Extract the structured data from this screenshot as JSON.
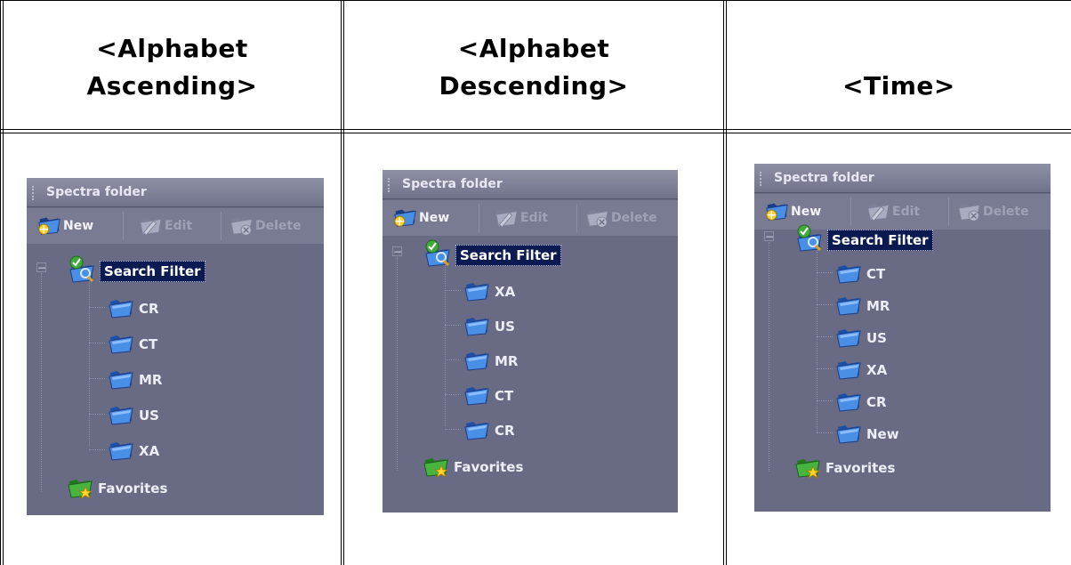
{
  "columns": [
    {
      "header": [
        "<Alphabet",
        "Ascending>"
      ],
      "panel": {
        "title": "Spectra folder",
        "toolbar": {
          "new": "New",
          "edit": "Edit",
          "delete": "Delete"
        },
        "root": "Search Filter",
        "children": [
          "CR",
          "CT",
          "MR",
          "US",
          "XA"
        ],
        "favorites": "Favorites"
      }
    },
    {
      "header": [
        "<Alphabet",
        "Descending>"
      ],
      "panel": {
        "title": "Spectra folder",
        "toolbar": {
          "new": "New",
          "edit": "Edit",
          "delete": "Delete"
        },
        "root": "Search Filter",
        "children": [
          "XA",
          "US",
          "MR",
          "CT",
          "CR"
        ],
        "favorites": "Favorites"
      }
    },
    {
      "header": [
        "",
        "<Time>"
      ],
      "panel": {
        "title": "Spectra folder",
        "toolbar": {
          "new": "New",
          "edit": "Edit",
          "delete": "Delete"
        },
        "root": "Search Filter",
        "children": [
          "CT",
          "MR",
          "US",
          "XA",
          "CR",
          "New"
        ],
        "favorites": "Favorites"
      }
    }
  ],
  "colors": {
    "panel_bg": "#686b83",
    "selection": "#0c1a52",
    "folder_blue": "#3a7fe0",
    "favorites_green": "#3fae3a"
  },
  "icons": {
    "new": "folder-new-icon",
    "edit": "folder-edit-icon",
    "delete": "folder-delete-icon",
    "filter": "search-filter-icon",
    "folder": "folder-icon",
    "favorites": "favorites-star-icon"
  }
}
